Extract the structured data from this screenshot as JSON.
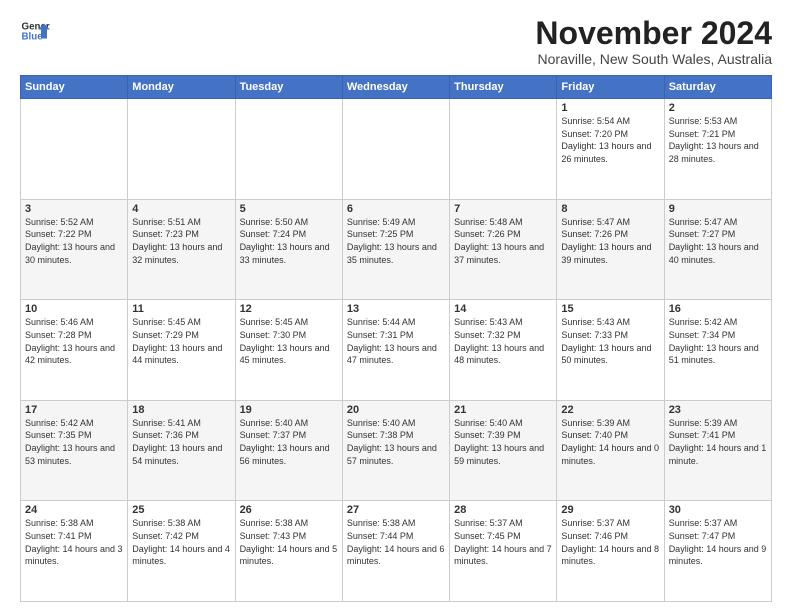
{
  "logo": {
    "line1": "General",
    "line2": "Blue"
  },
  "title": "November 2024",
  "location": "Noraville, New South Wales, Australia",
  "weekdays": [
    "Sunday",
    "Monday",
    "Tuesday",
    "Wednesday",
    "Thursday",
    "Friday",
    "Saturday"
  ],
  "weeks": [
    [
      {
        "day": "",
        "info": ""
      },
      {
        "day": "",
        "info": ""
      },
      {
        "day": "",
        "info": ""
      },
      {
        "day": "",
        "info": ""
      },
      {
        "day": "",
        "info": ""
      },
      {
        "day": "1",
        "info": "Sunrise: 5:54 AM\nSunset: 7:20 PM\nDaylight: 13 hours and 26 minutes."
      },
      {
        "day": "2",
        "info": "Sunrise: 5:53 AM\nSunset: 7:21 PM\nDaylight: 13 hours and 28 minutes."
      }
    ],
    [
      {
        "day": "3",
        "info": "Sunrise: 5:52 AM\nSunset: 7:22 PM\nDaylight: 13 hours and 30 minutes."
      },
      {
        "day": "4",
        "info": "Sunrise: 5:51 AM\nSunset: 7:23 PM\nDaylight: 13 hours and 32 minutes."
      },
      {
        "day": "5",
        "info": "Sunrise: 5:50 AM\nSunset: 7:24 PM\nDaylight: 13 hours and 33 minutes."
      },
      {
        "day": "6",
        "info": "Sunrise: 5:49 AM\nSunset: 7:25 PM\nDaylight: 13 hours and 35 minutes."
      },
      {
        "day": "7",
        "info": "Sunrise: 5:48 AM\nSunset: 7:26 PM\nDaylight: 13 hours and 37 minutes."
      },
      {
        "day": "8",
        "info": "Sunrise: 5:47 AM\nSunset: 7:26 PM\nDaylight: 13 hours and 39 minutes."
      },
      {
        "day": "9",
        "info": "Sunrise: 5:47 AM\nSunset: 7:27 PM\nDaylight: 13 hours and 40 minutes."
      }
    ],
    [
      {
        "day": "10",
        "info": "Sunrise: 5:46 AM\nSunset: 7:28 PM\nDaylight: 13 hours and 42 minutes."
      },
      {
        "day": "11",
        "info": "Sunrise: 5:45 AM\nSunset: 7:29 PM\nDaylight: 13 hours and 44 minutes."
      },
      {
        "day": "12",
        "info": "Sunrise: 5:45 AM\nSunset: 7:30 PM\nDaylight: 13 hours and 45 minutes."
      },
      {
        "day": "13",
        "info": "Sunrise: 5:44 AM\nSunset: 7:31 PM\nDaylight: 13 hours and 47 minutes."
      },
      {
        "day": "14",
        "info": "Sunrise: 5:43 AM\nSunset: 7:32 PM\nDaylight: 13 hours and 48 minutes."
      },
      {
        "day": "15",
        "info": "Sunrise: 5:43 AM\nSunset: 7:33 PM\nDaylight: 13 hours and 50 minutes."
      },
      {
        "day": "16",
        "info": "Sunrise: 5:42 AM\nSunset: 7:34 PM\nDaylight: 13 hours and 51 minutes."
      }
    ],
    [
      {
        "day": "17",
        "info": "Sunrise: 5:42 AM\nSunset: 7:35 PM\nDaylight: 13 hours and 53 minutes."
      },
      {
        "day": "18",
        "info": "Sunrise: 5:41 AM\nSunset: 7:36 PM\nDaylight: 13 hours and 54 minutes."
      },
      {
        "day": "19",
        "info": "Sunrise: 5:40 AM\nSunset: 7:37 PM\nDaylight: 13 hours and 56 minutes."
      },
      {
        "day": "20",
        "info": "Sunrise: 5:40 AM\nSunset: 7:38 PM\nDaylight: 13 hours and 57 minutes."
      },
      {
        "day": "21",
        "info": "Sunrise: 5:40 AM\nSunset: 7:39 PM\nDaylight: 13 hours and 59 minutes."
      },
      {
        "day": "22",
        "info": "Sunrise: 5:39 AM\nSunset: 7:40 PM\nDaylight: 14 hours and 0 minutes."
      },
      {
        "day": "23",
        "info": "Sunrise: 5:39 AM\nSunset: 7:41 PM\nDaylight: 14 hours and 1 minute."
      }
    ],
    [
      {
        "day": "24",
        "info": "Sunrise: 5:38 AM\nSunset: 7:41 PM\nDaylight: 14 hours and 3 minutes."
      },
      {
        "day": "25",
        "info": "Sunrise: 5:38 AM\nSunset: 7:42 PM\nDaylight: 14 hours and 4 minutes."
      },
      {
        "day": "26",
        "info": "Sunrise: 5:38 AM\nSunset: 7:43 PM\nDaylight: 14 hours and 5 minutes."
      },
      {
        "day": "27",
        "info": "Sunrise: 5:38 AM\nSunset: 7:44 PM\nDaylight: 14 hours and 6 minutes."
      },
      {
        "day": "28",
        "info": "Sunrise: 5:37 AM\nSunset: 7:45 PM\nDaylight: 14 hours and 7 minutes."
      },
      {
        "day": "29",
        "info": "Sunrise: 5:37 AM\nSunset: 7:46 PM\nDaylight: 14 hours and 8 minutes."
      },
      {
        "day": "30",
        "info": "Sunrise: 5:37 AM\nSunset: 7:47 PM\nDaylight: 14 hours and 9 minutes."
      }
    ]
  ]
}
